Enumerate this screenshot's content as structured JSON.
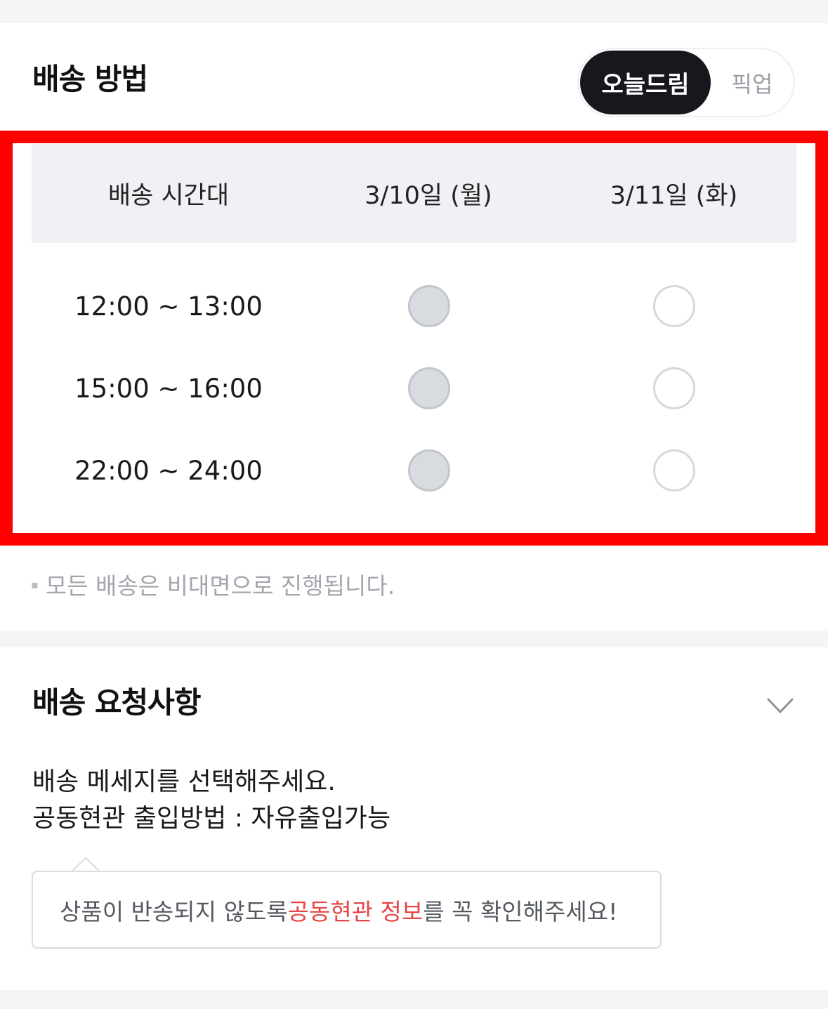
{
  "delivery_method": {
    "title": "배송 방법",
    "toggle": {
      "active_label": "오늘드림",
      "inactive_label": "픽업"
    }
  },
  "time_table": {
    "header": {
      "time_col": "배송 시간대",
      "day1": "3/10일 (월)",
      "day2": "3/11일 (화)"
    },
    "rows": [
      {
        "time": "12:00 ~ 13:00",
        "day1_state": "disabled",
        "day2_state": "available"
      },
      {
        "time": "15:00 ~ 16:00",
        "day1_state": "disabled",
        "day2_state": "available"
      },
      {
        "time": "22:00 ~ 24:00",
        "day1_state": "disabled",
        "day2_state": "available"
      }
    ]
  },
  "notice": {
    "bullet": "▪",
    "text": "모든 배송은 비대면으로 진행됩니다."
  },
  "delivery_request": {
    "title": "배송 요청사항",
    "expand_icon": "chevron-down-icon",
    "line1": "배송 메세지를 선택해주세요.",
    "line2": "공동현관 출입방법 : 자유출입가능",
    "tooltip": {
      "prefix": "상품이 반송되지 않도록 ",
      "emphasis": "공동현관 정보",
      "suffix": "를 꼭 확인해주세요!"
    }
  },
  "colors": {
    "highlight_border": "#ff0000",
    "active_toggle_bg": "#16181d",
    "emphasis_text": "#e64545",
    "disabled_radio": "#d8dbdf",
    "section_band": "#f4f5f7"
  }
}
